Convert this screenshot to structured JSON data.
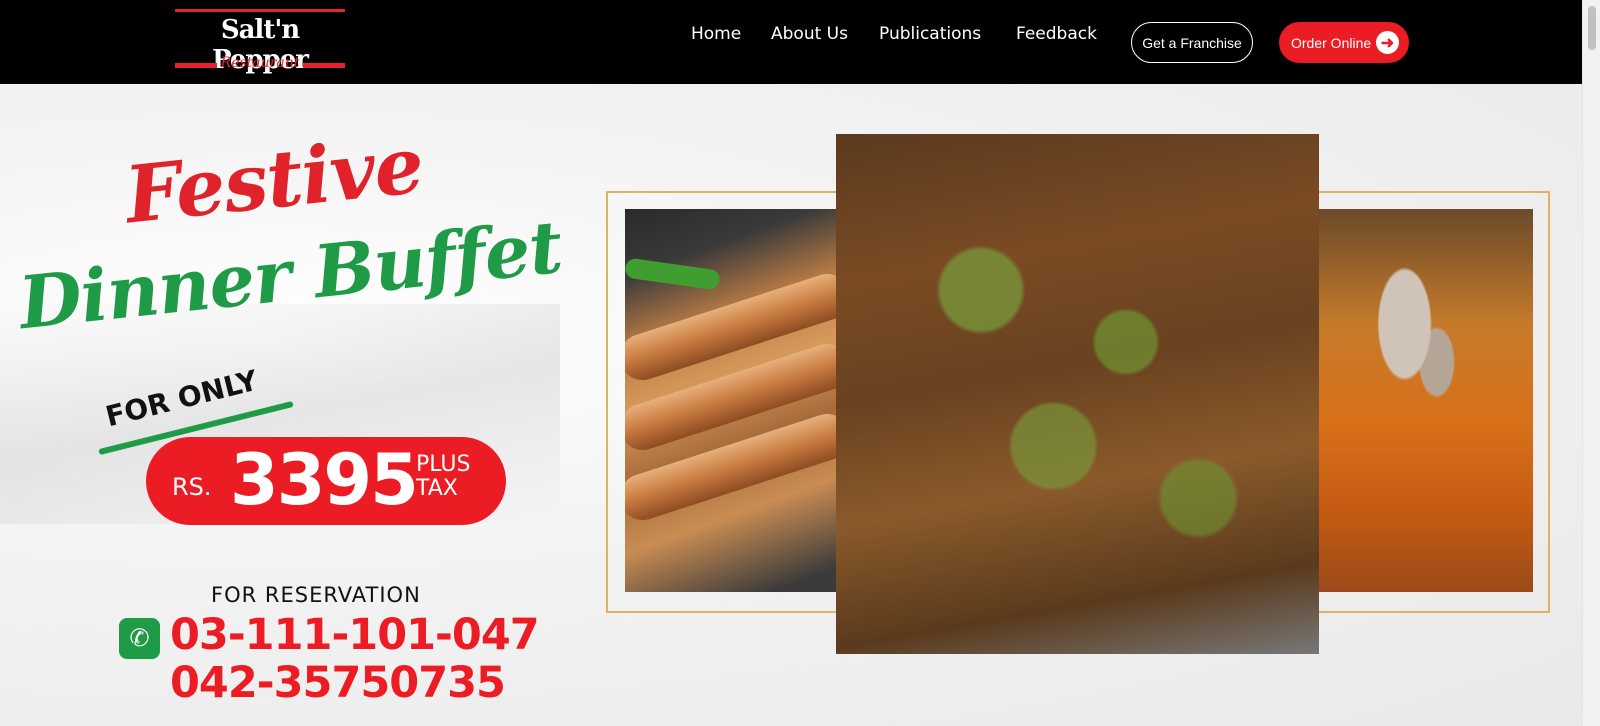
{
  "header": {
    "logo_title": "Salt'n Pepper",
    "logo_subtitle": "Restaurant",
    "nav": [
      {
        "label": "Home"
      },
      {
        "label": "About Us"
      },
      {
        "label": "Publications"
      },
      {
        "label": "Feedback"
      }
    ],
    "franchise_button": "Get a Franchise",
    "order_button": "Order Online",
    "order_icon": "arrow-right-icon"
  },
  "hero": {
    "headline_1": "Festive",
    "headline_2": "Dinner Buffet",
    "for_only": "FOR ONLY",
    "currency": "RS.",
    "price": "3395",
    "plus_tax_1": "PLUS",
    "plus_tax_2": "TAX",
    "reservation_label": "FOR RESERVATION",
    "phone_icon": "phone-icon",
    "phone_1": "03-111-101-047",
    "phone_2": "042-35750735"
  },
  "colors": {
    "red": "#ec1c24",
    "green": "#1f9a47",
    "nav_bg": "#000000",
    "frame_gold": "#e0b160"
  }
}
